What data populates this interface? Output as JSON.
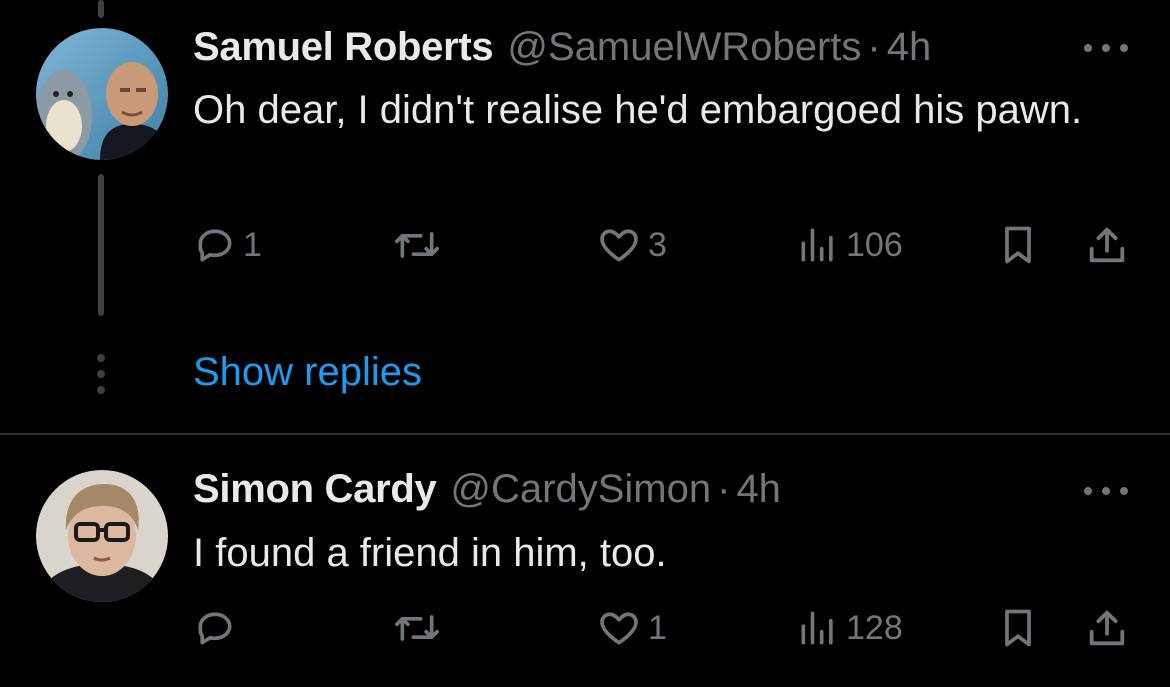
{
  "tweets": [
    {
      "author_name": "Samuel Roberts",
      "handle": "@SamuelWRoberts",
      "separator": "·",
      "time": "4h",
      "text": "Oh dear, I didn't realise he'd embargoed his pawn.",
      "reply_count": "1",
      "retweet_count": "",
      "like_count": "3",
      "view_count": "106"
    },
    {
      "author_name": "Simon Cardy",
      "handle": "@CardySimon",
      "separator": "·",
      "time": "4h",
      "text": "I found a friend in him, too.",
      "reply_count": "",
      "retweet_count": "",
      "like_count": "1",
      "view_count": "128"
    }
  ],
  "show_replies_label": "Show replies",
  "colors": {
    "background": "#000000",
    "text_primary": "#e7e9ea",
    "text_secondary": "#71767b",
    "link": "#1d9bf0",
    "divider": "#2f3336"
  },
  "icons": [
    "reply-icon",
    "retweet-icon",
    "like-icon",
    "views-icon",
    "bookmark-icon",
    "share-icon",
    "more-icon"
  ]
}
